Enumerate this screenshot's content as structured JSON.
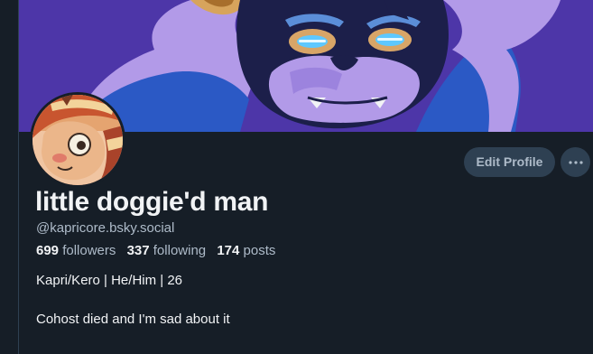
{
  "profile": {
    "display_name": "little doggie'd man",
    "handle": "@kapricore.bsky.social",
    "followers_count": "699",
    "followers_label": "followers",
    "following_count": "337",
    "following_label": "following",
    "posts_count": "174",
    "posts_label": "posts",
    "bio": [
      "Kapri/Kero | He/Him | 26",
      "Cohost died and I'm sad about it"
    ]
  },
  "actions": {
    "edit_profile_label": "Edit Profile",
    "more_icon": "ellipsis-icon"
  },
  "colors": {
    "background": "#161e27",
    "button_background": "#2e4052",
    "text_primary": "#f1f3f5",
    "text_secondary": "#aebbc9",
    "banner_purple": "#4d36a8"
  }
}
